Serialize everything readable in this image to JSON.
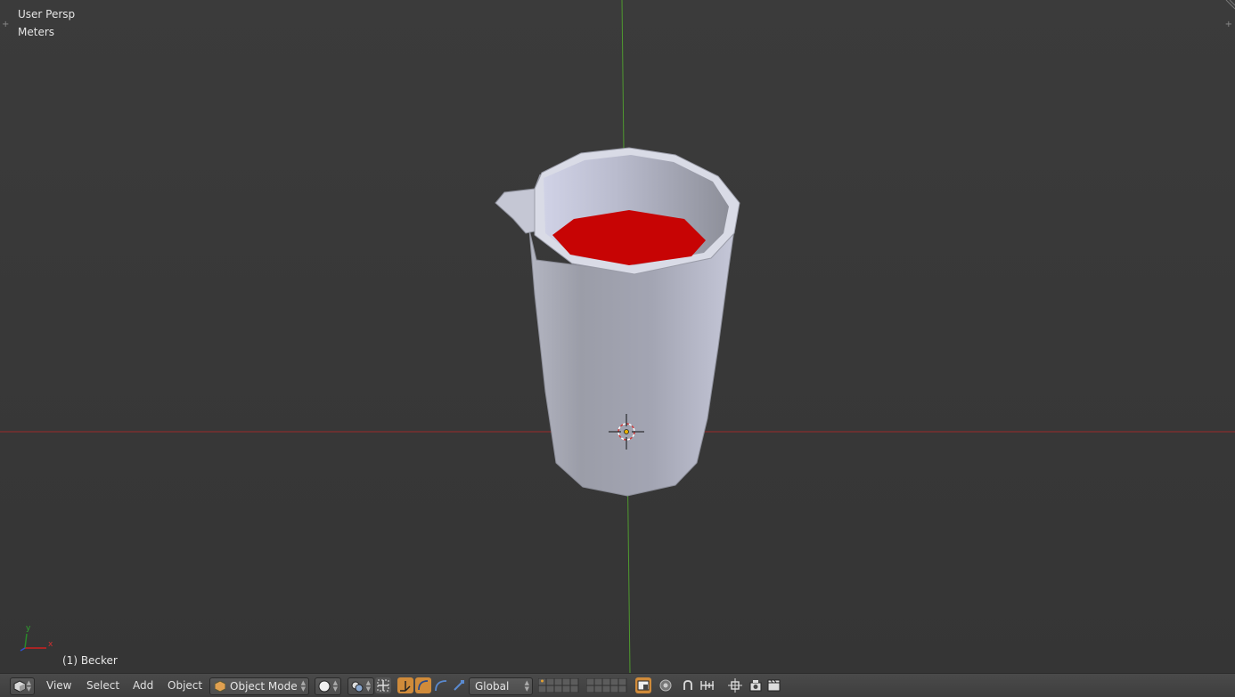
{
  "viewport": {
    "view_name": "User Persp",
    "units": "Meters",
    "active_object": "(1) Becker",
    "colors": {
      "x_axis": "#b02b2b",
      "y_axis": "#4f9a2f",
      "liquid": "#c80000",
      "mesh": "#a8aab8"
    }
  },
  "axis_gizmo": {
    "x_label": "x",
    "y_label": "y"
  },
  "header": {
    "menus": [
      "View",
      "Select",
      "Add",
      "Object"
    ],
    "mode": "Object Mode",
    "orientation": "Global"
  },
  "icons": [
    "editor-type-icon",
    "viewport-shading-icon",
    "pivot-point-icon",
    "manipulator-toggle-icon",
    "translate-icon",
    "rotate-icon",
    "scale-icon",
    "layers-grid",
    "lock-camera-icon",
    "proportional-edit-icon",
    "snap-icon",
    "snap-element-icon",
    "opengl-render-icon",
    "opengl-animation-icon"
  ]
}
